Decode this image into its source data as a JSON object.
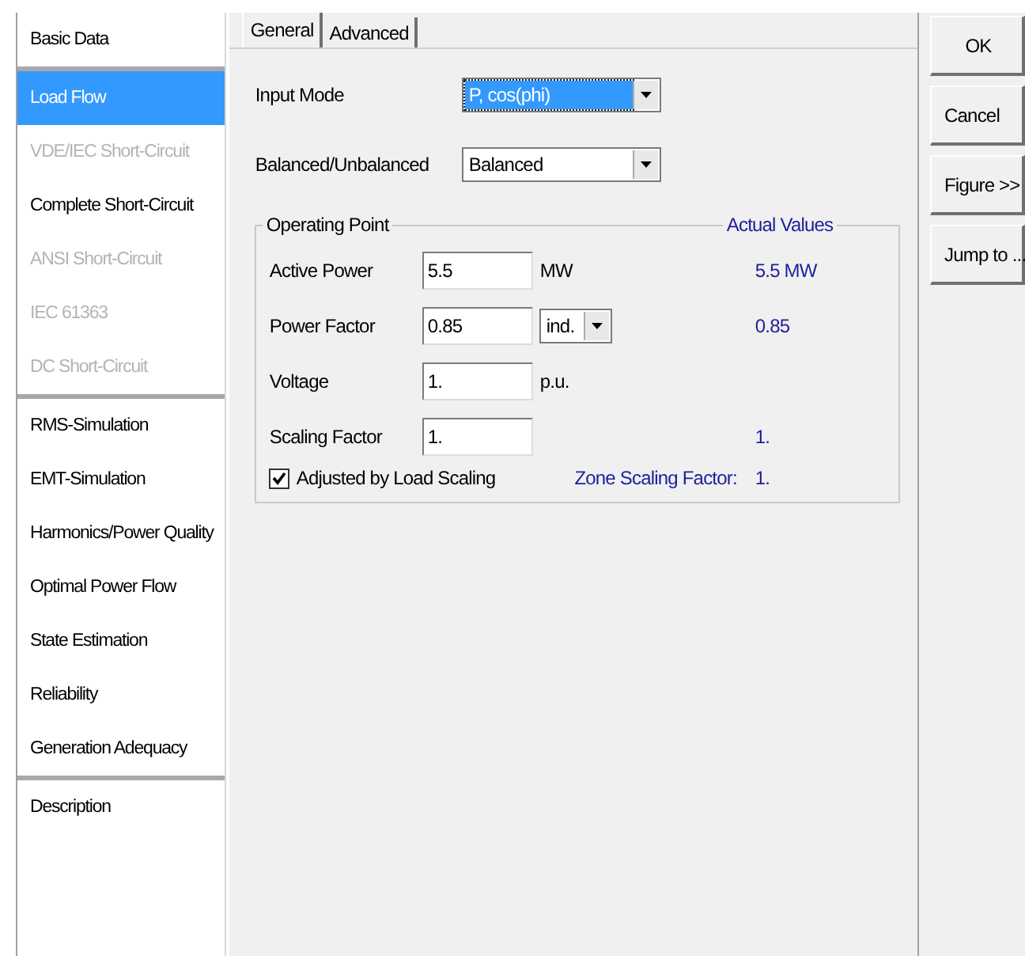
{
  "sidebar": {
    "groups": [
      {
        "items": [
          {
            "label": "Basic Data",
            "selected": false,
            "disabled": false
          }
        ]
      },
      {
        "items": [
          {
            "label": "Load Flow",
            "selected": true,
            "disabled": false
          },
          {
            "label": "VDE/IEC Short-Circuit",
            "selected": false,
            "disabled": true
          },
          {
            "label": "Complete Short-Circuit",
            "selected": false,
            "disabled": false
          },
          {
            "label": "ANSI Short-Circuit",
            "selected": false,
            "disabled": true
          },
          {
            "label": "IEC 61363",
            "selected": false,
            "disabled": true
          },
          {
            "label": "DC Short-Circuit",
            "selected": false,
            "disabled": true
          }
        ]
      },
      {
        "items": [
          {
            "label": "RMS-Simulation",
            "selected": false,
            "disabled": false
          },
          {
            "label": "EMT-Simulation",
            "selected": false,
            "disabled": false
          },
          {
            "label": "Harmonics/Power Quality",
            "selected": false,
            "disabled": false
          },
          {
            "label": "Optimal Power Flow",
            "selected": false,
            "disabled": false
          },
          {
            "label": "State Estimation",
            "selected": false,
            "disabled": false
          },
          {
            "label": "Reliability",
            "selected": false,
            "disabled": false
          },
          {
            "label": "Generation Adequacy",
            "selected": false,
            "disabled": false
          }
        ]
      },
      {
        "items": [
          {
            "label": "Description",
            "selected": false,
            "disabled": false
          }
        ]
      }
    ]
  },
  "tabs": [
    {
      "label": "General",
      "selected": true
    },
    {
      "label": "Advanced",
      "selected": false
    }
  ],
  "selects": [
    {
      "label": "Input Mode",
      "value": "P, cos(phi)",
      "focused": true
    },
    {
      "label": "Balanced/Unbalanced",
      "value": "Balanced",
      "focused": false
    }
  ],
  "operating_point": {
    "title": "Operating Point",
    "actual_title": "Actual Values",
    "rows": [
      {
        "label": "Active Power",
        "value": "5.5",
        "unit": {
          "kind": "text",
          "text": "MW"
        },
        "actual": "5.5 MW"
      },
      {
        "label": "Power Factor",
        "value": "0.85",
        "unit": {
          "kind": "select",
          "text": "ind."
        },
        "actual": "0.85"
      },
      {
        "label": "Voltage",
        "value": "1.",
        "unit": {
          "kind": "text",
          "text": "p.u."
        }
      },
      {
        "label": "Scaling Factor",
        "value": "1.",
        "actual": "1."
      }
    ],
    "checkbox": {
      "label": "Adjusted by Load Scaling",
      "checked": true
    },
    "zone_label": "Zone Scaling Factor:",
    "zone_value": "1."
  },
  "buttons": [
    "OK",
    "Cancel",
    "Figure >>",
    "Jump to ..."
  ]
}
